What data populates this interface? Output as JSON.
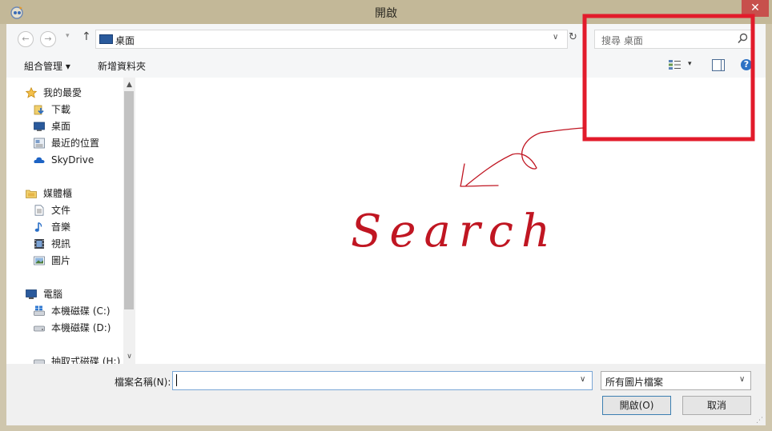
{
  "window": {
    "title": "開啟",
    "close_glyph": "✕"
  },
  "nav": {
    "back_glyph": "←",
    "forward_glyph": "→",
    "recent_glyph": "▾",
    "up_glyph": "↑"
  },
  "address": {
    "location": "桌面",
    "dropdown_glyph": "∨",
    "refresh_glyph": "↻"
  },
  "search": {
    "placeholder": "搜尋 桌面"
  },
  "toolbar": {
    "organize": "組合管理 ▾",
    "new_folder": "新增資料夾",
    "views_drop": "▾",
    "help": "?"
  },
  "sidebar": {
    "favorites": {
      "label": "我的最愛",
      "icon": "star-icon"
    },
    "favorite_items": [
      {
        "label": "下載",
        "icon": "downloads-folder-icon"
      },
      {
        "label": "桌面",
        "icon": "desktop-icon"
      },
      {
        "label": "最近的位置",
        "icon": "recent-places-icon"
      },
      {
        "label": "SkyDrive",
        "icon": "skydrive-cloud-icon"
      }
    ],
    "libraries": {
      "label": "媒體櫃",
      "icon": "library-folder-icon"
    },
    "library_items": [
      {
        "label": "文件",
        "icon": "document-icon"
      },
      {
        "label": "音樂",
        "icon": "music-icon"
      },
      {
        "label": "視訊",
        "icon": "video-icon"
      },
      {
        "label": "圖片",
        "icon": "picture-icon"
      }
    ],
    "computer": {
      "label": "電腦",
      "icon": "computer-icon"
    },
    "computer_items": [
      {
        "label": "本機磁碟 (C:)",
        "icon": "windows-drive-icon"
      },
      {
        "label": "本機磁碟 (D:)",
        "icon": "drive-icon"
      },
      {
        "label": "抽取式磁碟 (H:)",
        "icon": "removable-drive-icon"
      }
    ],
    "scroll_up": "▲",
    "scroll_down": "∨"
  },
  "bottom": {
    "filename_label": "檔案名稱(N):",
    "filename_value": "",
    "filetype": "所有圖片檔案",
    "dropdown_glyph": "∨",
    "open_button": "開啟(O)",
    "cancel_button": "取消",
    "grip": "⋰"
  },
  "annotation": {
    "text": "Search",
    "color": "#c01622",
    "box_color": "#e21b2b"
  }
}
